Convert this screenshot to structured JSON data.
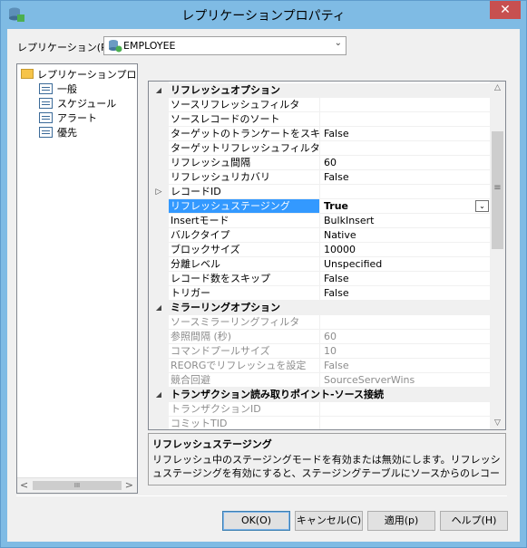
{
  "window": {
    "title": "レプリケーションプロパティ",
    "close_label": "✕"
  },
  "replication": {
    "label": "レプリケーション(R)",
    "value": "EMPLOYEE"
  },
  "tree": {
    "root": "レプリケーションプロパティ",
    "items": [
      "一般",
      "スケジュール",
      "アラート",
      "優先"
    ]
  },
  "grid": {
    "categories": [
      "リフレッシュオプション",
      "ミラーリングオプション",
      "トランザクション読み取りポイント-ソース接続"
    ],
    "refresh": [
      {
        "name": "ソースリフレッシュフィルタ",
        "value": ""
      },
      {
        "name": "ソースレコードのソート",
        "value": ""
      },
      {
        "name": "ターゲットのトランケートをスキップ",
        "value": "False"
      },
      {
        "name": "ターゲットリフレッシュフィルタ",
        "value": ""
      },
      {
        "name": "リフレッシュ間隔",
        "value": "60"
      },
      {
        "name": "リフレッシュリカバリ",
        "value": "False"
      },
      {
        "name": "レコードID",
        "value": ""
      },
      {
        "name": "リフレッシュステージング",
        "value": "True"
      },
      {
        "name": "Insertモード",
        "value": "BulkInsert"
      },
      {
        "name": "バルクタイプ",
        "value": "Native"
      },
      {
        "name": "ブロックサイズ",
        "value": "10000"
      },
      {
        "name": "分離レベル",
        "value": "Unspecified"
      },
      {
        "name": "レコード数をスキップ",
        "value": "False"
      },
      {
        "name": "トリガー",
        "value": "False"
      }
    ],
    "mirroring": [
      {
        "name": "ソースミラーリングフィルタ",
        "value": ""
      },
      {
        "name": "参照間隔 (秒)",
        "value": "60"
      },
      {
        "name": "コマンドプールサイズ",
        "value": "10"
      },
      {
        "name": "REORGでリフレッシュを設定",
        "value": "False"
      },
      {
        "name": "競合回避",
        "value": "SourceServerWins"
      }
    ],
    "transaction": [
      {
        "name": "トランザクションID",
        "value": ""
      },
      {
        "name": "コミットTID",
        "value": ""
      }
    ]
  },
  "description": {
    "title": "リフレッシュステージング",
    "text": "リフレッシュ中のステージングモードを有効または無効にします。リフレッシュステージングを有効にすると、ステージングテーブルにソースからのレコードが入力され、そのコ..."
  },
  "buttons": {
    "ok": "OK(O)",
    "cancel": "キャンセル(C)",
    "apply": "適用(p)",
    "help": "ヘルプ(H)"
  },
  "colors": {
    "titlebar": "#7fbbe4",
    "selection": "#3399ff",
    "close": "#c75050"
  }
}
